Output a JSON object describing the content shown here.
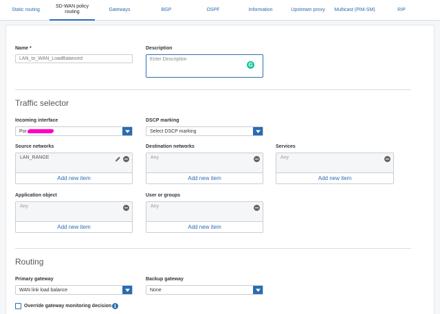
{
  "tabs": [
    {
      "label": "Static routing"
    },
    {
      "label": "SD-WAN policy routing"
    },
    {
      "label": "Gateways"
    },
    {
      "label": "BGP"
    },
    {
      "label": "OSPF"
    },
    {
      "label": "Information"
    },
    {
      "label": "Upstream proxy"
    },
    {
      "label": "Multicast (PIM-SM)"
    },
    {
      "label": "RIP"
    }
  ],
  "active_tab": "SD-WAN policy routing",
  "form": {
    "name_label": "Name",
    "name_required": "*",
    "name_placeholder": "LAN_to_WAN_LoadBalanced",
    "description_label": "Description",
    "description_placeholder": "Enter Description",
    "grammarly_letter": "G"
  },
  "traffic_selector": {
    "title": "Traffic selector",
    "incoming_interface_label": "Incoming interface",
    "incoming_interface_value": "Por",
    "dscp_label": "DSCP marking",
    "dscp_value": "Select DSCP marking",
    "source_networks_label": "Source networks",
    "source_networks_item": "LAN_RANGE",
    "destination_networks_label": "Destination networks",
    "destination_networks_item": "Any",
    "services_label": "Services",
    "services_item": "Any",
    "application_object_label": "Application object",
    "application_object_item": "Any",
    "user_groups_label": "User or groups",
    "user_groups_item": "Any",
    "add_new_item": "Add new item"
  },
  "routing": {
    "title": "Routing",
    "primary_gateway_label": "Primary gateway",
    "primary_gateway_value": "WAN link load balance",
    "backup_gateway_label": "Backup gateway",
    "backup_gateway_value": "None",
    "override_label": "Override gateway monitoring decision",
    "info_glyph": "i"
  },
  "colors": {
    "accent": "#2b6cb0",
    "redaction": "#ff00c8",
    "grammarly": "#15c39a"
  }
}
